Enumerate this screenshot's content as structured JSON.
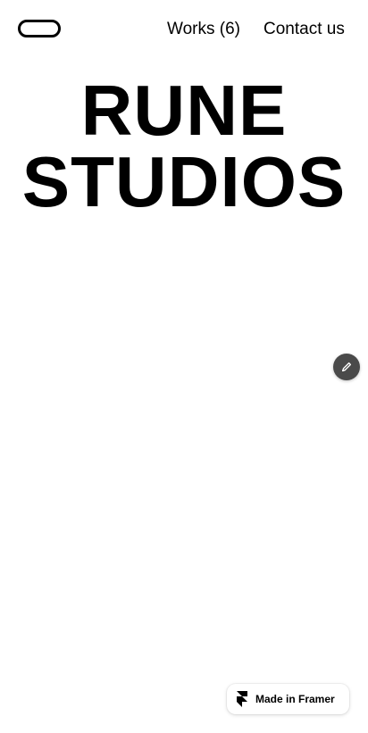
{
  "header": {
    "logo_icon": "pill-outline-logo",
    "nav": {
      "works_label": "Works (6)",
      "contact_label": "Contact us"
    }
  },
  "hero": {
    "line1": "RUNE",
    "line2": "STUDIOS"
  },
  "edit_button": {
    "icon": "pencil-icon",
    "color": "#4a4a4a"
  },
  "framer_badge": {
    "icon": "framer-icon",
    "label": "Made in Framer"
  }
}
